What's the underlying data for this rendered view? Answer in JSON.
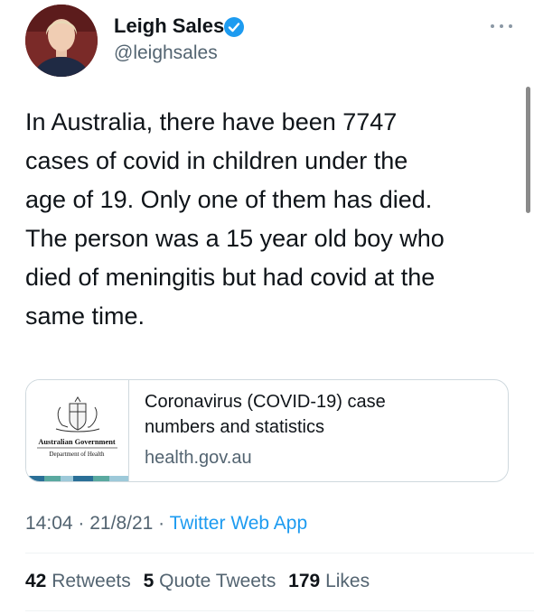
{
  "author": {
    "name": "Leigh Sales",
    "handle": "@leighsales"
  },
  "tweet": {
    "lines": [
      "In Australia, there have been 7747",
      "cases of covid in children under the",
      "age of 19.  Only one of them has died.",
      "The person was a 15 year old boy who",
      "died of meningitis but had covid at the",
      "same time."
    ]
  },
  "card": {
    "logo_line1": "Australian Government",
    "logo_line2": "Department of Health",
    "title_line1": "Coronavirus (COVID-19) case",
    "title_line2": "numbers and statistics",
    "domain": "health.gov.au"
  },
  "meta": {
    "time": "14:04",
    "date": "21/8/21",
    "separator": "·",
    "app": "Twitter Web App"
  },
  "stats": {
    "retweets_count": "42",
    "retweets_label": "Retweets",
    "quotes_count": "5",
    "quotes_label": "Quote Tweets",
    "likes_count": "179",
    "likes_label": "Likes"
  },
  "colors": {
    "verified": "#1d9bf0",
    "link": "#1d9bf0",
    "secondary_text": "#536471"
  }
}
